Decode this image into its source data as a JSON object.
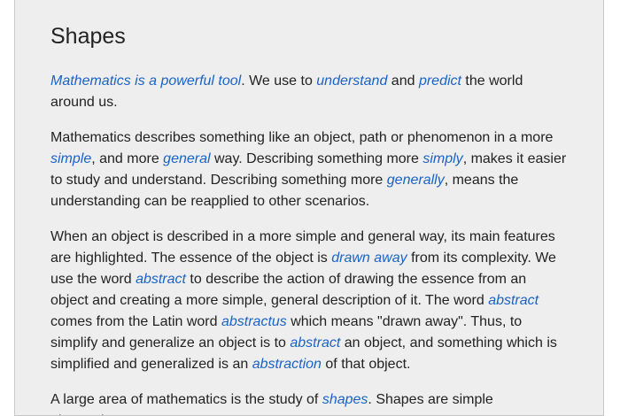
{
  "title": "Shapes",
  "colors": {
    "link": "#1a63c6",
    "page_background": "#eeeeee",
    "text": "#222222"
  },
  "paragraphs": [
    {
      "segments": [
        {
          "link": "Mathematics is a powerful tool"
        },
        {
          "text": ". We use to "
        },
        {
          "link": "understand"
        },
        {
          "text": " and "
        },
        {
          "link": "predict"
        },
        {
          "text": " the world around us."
        }
      ]
    },
    {
      "segments": [
        {
          "text": "Mathematics describes something like an object, path or phenomenon in a more "
        },
        {
          "link": "simple"
        },
        {
          "text": ", and more "
        },
        {
          "link": "general"
        },
        {
          "text": " way. Describing something more "
        },
        {
          "link": "simply"
        },
        {
          "text": ", makes it easier to study and understand. Describing something more "
        },
        {
          "link": "generally"
        },
        {
          "text": ", means the understanding can be reapplied to other scenarios."
        }
      ]
    },
    {
      "segments": [
        {
          "text": "When an object is described in a more simple and general way, its main features are highlighted. The essence of the object is "
        },
        {
          "link": "drawn away"
        },
        {
          "text": " from its complexity. We use the word "
        },
        {
          "link": "abstract"
        },
        {
          "text": " to describe the action of drawing the essence from an object and creating a more simple, general description of it. The word "
        },
        {
          "link": "abstract"
        },
        {
          "text": " comes from the Latin word "
        },
        {
          "link": "abstractus"
        },
        {
          "text": " which means \"drawn away\". Thus, to simplify and generalize an object is to "
        },
        {
          "link": "abstract"
        },
        {
          "text": " an object, and something which is simplified and generalized is an "
        },
        {
          "link": "abstraction"
        },
        {
          "text": " of that object."
        }
      ]
    },
    {
      "segments": [
        {
          "text": "A large area of mathematics is the study of "
        },
        {
          "link": "shapes"
        },
        {
          "text": ". Shapes are simple abstractions"
        }
      ]
    }
  ]
}
